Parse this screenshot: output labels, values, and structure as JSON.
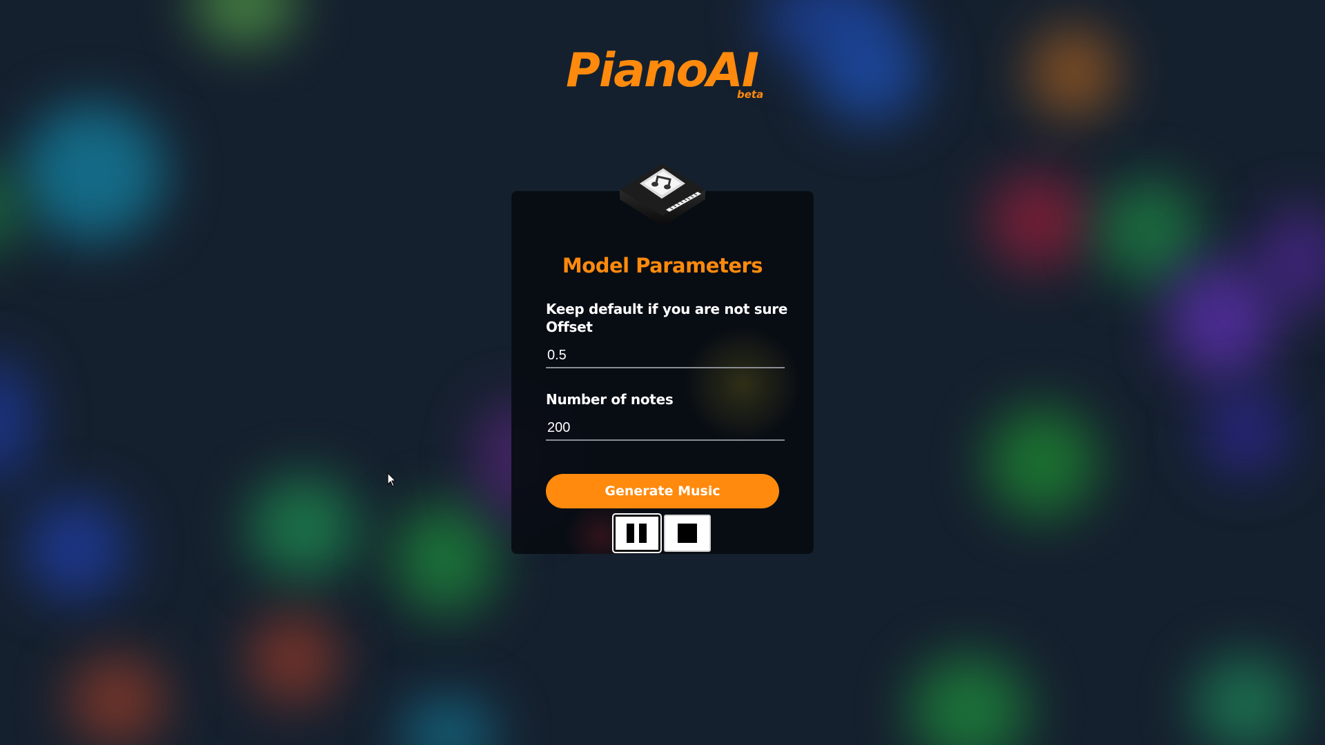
{
  "header": {
    "logo_text": "PianoAI",
    "logo_badge": "beta"
  },
  "card": {
    "title": "Model Parameters",
    "hint": "Keep default if you are not sure",
    "offset_label": "Offset",
    "offset_value": "0.5",
    "notes_label": "Number of notes",
    "notes_value": "200",
    "generate_label": "Generate Music",
    "icon": "piano-music-chip-icon"
  },
  "controls": {
    "pause_icon": "pause-icon",
    "stop_icon": "stop-icon"
  },
  "colors": {
    "accent": "#ff8a0d",
    "background": "#15202e",
    "card": "#080c12",
    "text": "#ffffff"
  }
}
